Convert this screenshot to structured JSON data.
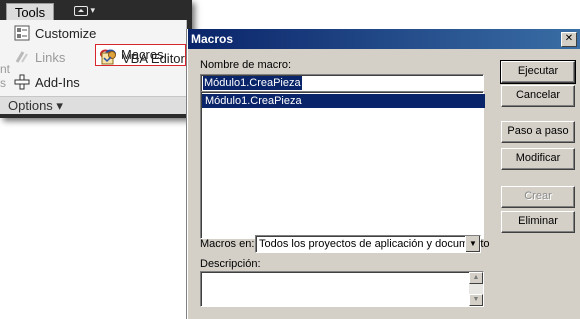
{
  "ribbon": {
    "tab_label": "Tools",
    "footer_label": "Options ▾",
    "side_fragment": "nt\ns",
    "items": {
      "customize": "Customize",
      "links": "Links",
      "addins": "Add-Ins",
      "macros": "Macros",
      "vba_editor": "VBA Editor"
    },
    "highlight_color": "#d9262c"
  },
  "dialog": {
    "title": "Macros",
    "close_glyph": "✕",
    "macro_name_label": "Nombre de macro:",
    "macro_name_value": "Módulo1.CreaPieza",
    "macro_list": [
      "Módulo1.CreaPieza"
    ],
    "macros_in_label": "Macros en:",
    "macros_in_value": "Todos los proyectos de aplicación y documento",
    "description_label": "Descripción:",
    "buttons": {
      "run": "Ejecutar",
      "cancel": "Cancelar",
      "step_into": "Paso a paso",
      "edit": "Modificar",
      "create": "Crear",
      "delete": "Eliminar"
    },
    "titlebar_color": "#0a246a",
    "face_color": "#d4d0c8"
  }
}
